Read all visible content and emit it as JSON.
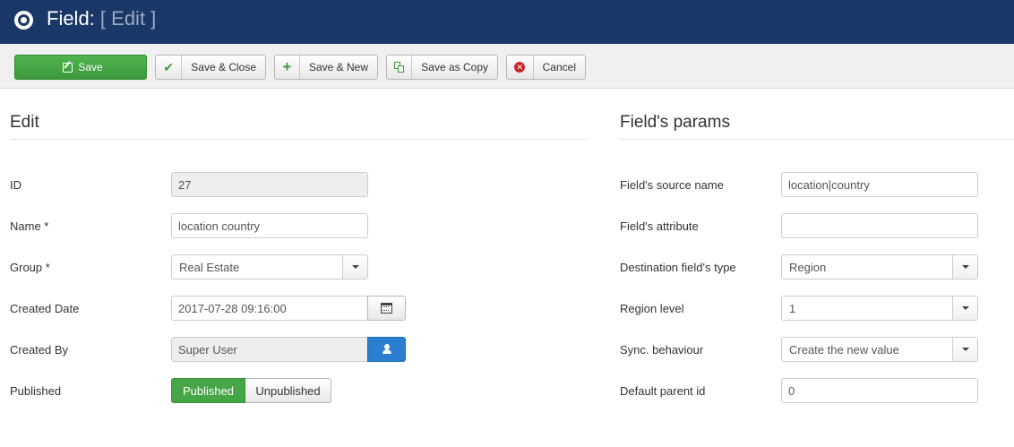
{
  "header": {
    "title": "Field:",
    "subtitle": "[ Edit ]"
  },
  "toolbar": {
    "save_label": "Save",
    "save_close_label": "Save & Close",
    "save_new_label": "Save & New",
    "save_copy_label": "Save as Copy",
    "cancel_label": "Cancel"
  },
  "edit": {
    "title": "Edit",
    "fields": {
      "id": {
        "label": "ID",
        "value": "27"
      },
      "name": {
        "label": "Name *",
        "value": "location country"
      },
      "group": {
        "label": "Group *",
        "value": "Real Estate"
      },
      "created_date": {
        "label": "Created Date",
        "value": "2017-07-28 09:16:00"
      },
      "created_by": {
        "label": "Created By",
        "value": "Super User"
      },
      "published": {
        "label": "Published",
        "on_label": "Published",
        "off_label": "Unpublished",
        "selected": "Published"
      }
    }
  },
  "params": {
    "title": "Field's params",
    "fields": {
      "source_name": {
        "label": "Field's source name",
        "value": "location|country"
      },
      "attribute": {
        "label": "Field's attribute",
        "value": ""
      },
      "dest_type": {
        "label": "Destination field's type",
        "value": "Region"
      },
      "region_level": {
        "label": "Region level",
        "value": "1"
      },
      "sync": {
        "label": "Sync. behaviour",
        "value": "Create the new value"
      },
      "parent_id": {
        "label": "Default parent id",
        "value": "0"
      }
    }
  },
  "colors": {
    "header_bg": "#1a3867",
    "save_green": "#46a546",
    "user_blue": "#2a7fd0",
    "cancel_red": "#c52827"
  }
}
